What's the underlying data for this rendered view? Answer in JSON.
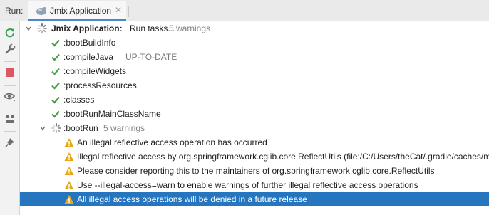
{
  "header": {
    "run_label": "Run:",
    "tab_title": "Jmix Application",
    "tab_close": "✕"
  },
  "sidebar": {
    "tools": [
      "rerun-icon",
      "settings-wrench-icon",
      "stop-icon",
      "view-options-icon",
      "layout-icon",
      "pin-icon"
    ]
  },
  "tree": {
    "root_label": "Jmix Application:",
    "root_status": "Run tasks...",
    "root_warnings": "5 warnings",
    "tasks": [
      {
        "name": ":bootBuildInfo",
        "note": ""
      },
      {
        "name": ":compileJava",
        "note": "UP-TO-DATE"
      },
      {
        "name": ":compileWidgets",
        "note": ""
      },
      {
        "name": ":processResources",
        "note": ""
      },
      {
        "name": ":classes",
        "note": ""
      },
      {
        "name": ":bootRunMainClassName",
        "note": ""
      }
    ],
    "bootrun_label": ":bootRun",
    "bootrun_warnings": "5 warnings",
    "warnings": [
      "An illegal reflective access operation has occurred",
      "Illegal reflective access by org.springframework.cglib.core.ReflectUtils (file:/C:/Users/theCat/.gradle/caches/m",
      "Please consider reporting this to the maintainers of org.springframework.cglib.core.ReflectUtils",
      "Use --illegal-access=warn to enable warnings of further illegal reflective access operations",
      "All illegal access operations will be denied in a future release"
    ],
    "selected_index": 4
  },
  "colors": {
    "selection": "#2675bf",
    "success_check": "#4a9e4a",
    "warning": "#e6a817",
    "stop": "#db5860",
    "rerun": "#3f9e57"
  }
}
